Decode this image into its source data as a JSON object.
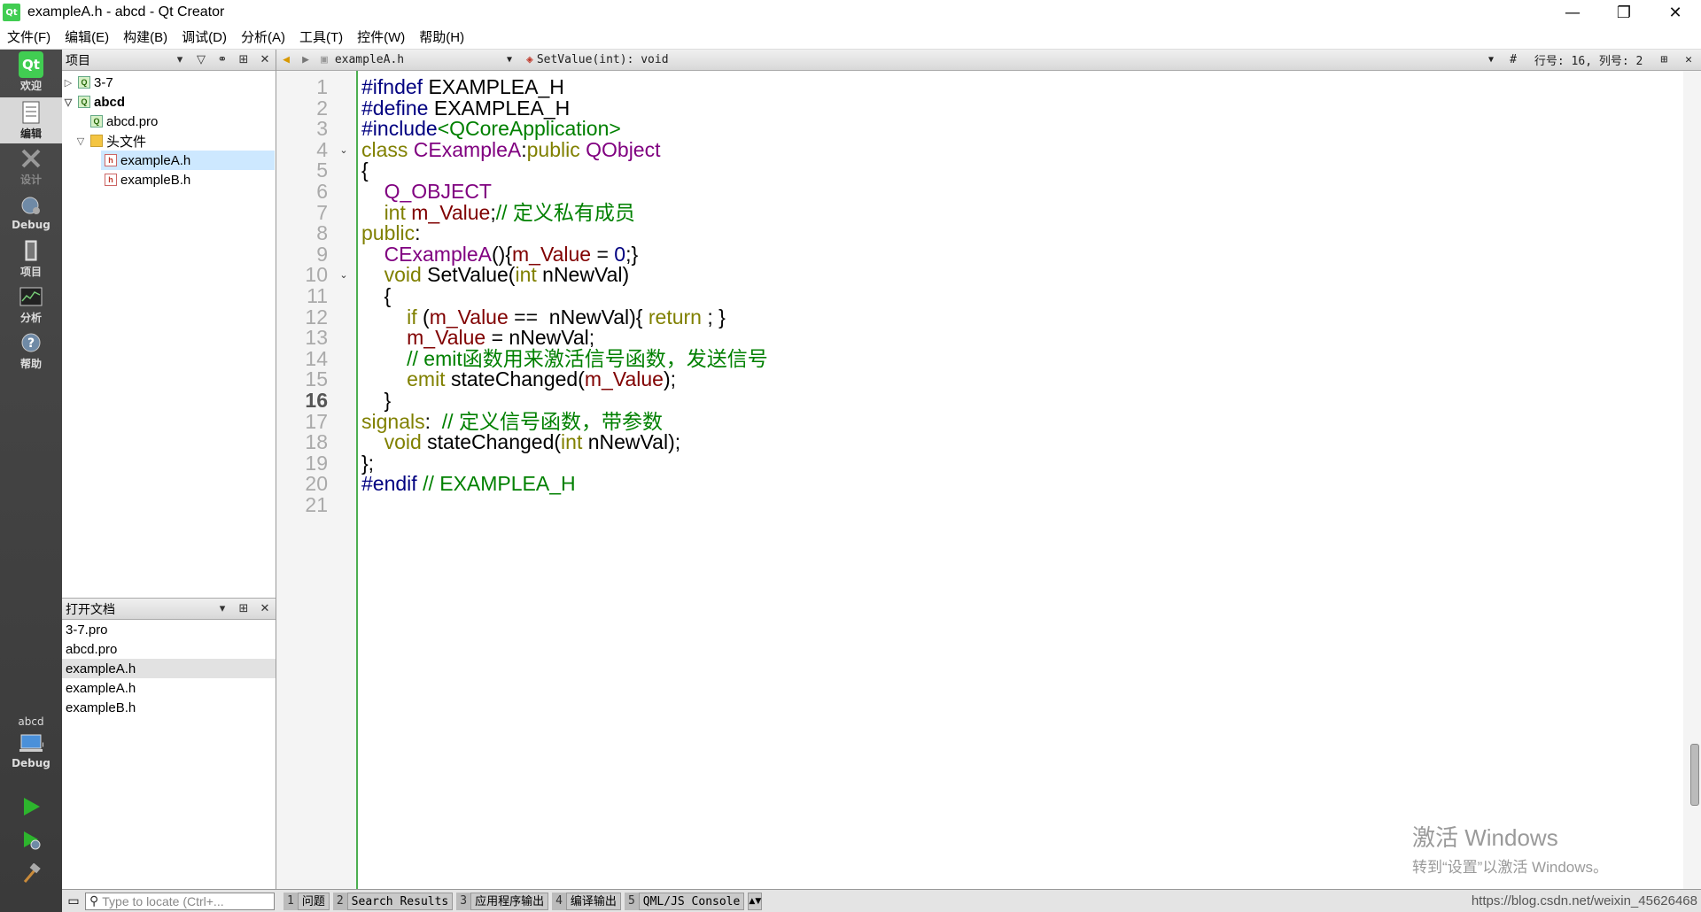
{
  "window": {
    "app_icon": "Qt",
    "title": "exampleA.h - abcd - Qt Creator",
    "buttons": [
      "minimize-icon",
      "restore-icon",
      "close-icon"
    ]
  },
  "menu": [
    "文件(F)",
    "编辑(E)",
    "构建(B)",
    "调试(D)",
    "分析(A)",
    "工具(T)",
    "控件(W)",
    "帮助(H)"
  ],
  "modes": [
    {
      "label": "欢迎",
      "icon": "Qt"
    },
    {
      "label": "编辑",
      "icon": "edit-icon"
    },
    {
      "label": "设计",
      "icon": "design-icon"
    },
    {
      "label": "Debug",
      "icon": "debug-icon"
    },
    {
      "label": "项目",
      "icon": "project-icon"
    },
    {
      "label": "分析",
      "icon": "analyze-icon"
    },
    {
      "label": "帮助",
      "icon": "help-icon"
    }
  ],
  "kit": {
    "project": "abcd",
    "label": "Debug"
  },
  "project_pane": {
    "title": "项目",
    "tree": [
      {
        "label": "3-7",
        "icon": "pro",
        "expanded": false,
        "bold": false
      },
      {
        "label": "abcd",
        "icon": "pro",
        "expanded": true,
        "bold": true
      },
      {
        "label": "abcd.pro",
        "icon": "pro"
      },
      {
        "label": "头文件",
        "icon": "folder",
        "expanded": true
      },
      {
        "label": "exampleA.h",
        "icon": "h",
        "selected": true
      },
      {
        "label": "exampleB.h",
        "icon": "h"
      }
    ]
  },
  "open_docs": {
    "title": "打开文档",
    "items": [
      "3-7.pro",
      "abcd.pro",
      "exampleA.h",
      "exampleA.h",
      "exampleB.h"
    ],
    "selected_index": 2
  },
  "editor_toolbar": {
    "file": "exampleA.h",
    "symbol": "SetValue(int): void",
    "hash": "#",
    "position": "行号: 16, 列号: 2"
  },
  "editor": {
    "current_line": 16,
    "folds": [
      4,
      10
    ],
    "lines": [
      "#ifndef EXAMPLEA_H",
      "#define EXAMPLEA_H",
      "#include<QCoreApplication>",
      "class CExampleA:public QObject",
      "{",
      "    Q_OBJECT",
      "    int m_Value;// 定义私有成员",
      "public:",
      "    CExampleA(){m_Value = 0;}",
      "    void SetValue(int nNewVal)",
      "    {",
      "        if (m_Value ==  nNewVal){ return ; }",
      "        m_Value = nNewVal;",
      "        // emit函数用来激活信号函数，发送信号",
      "        emit stateChanged(m_Value);",
      "    }",
      "signals:  // 定义信号函数，带参数",
      "    void stateChanged(int nNewVal);",
      "};",
      "#endif // EXAMPLEA_H",
      ""
    ]
  },
  "statusbar": {
    "locate_placeholder": "Type to locate (Ctrl+...",
    "tabs": [
      {
        "num": "1",
        "label": "问题"
      },
      {
        "num": "2",
        "label": "Search Results"
      },
      {
        "num": "3",
        "label": "应用程序输出"
      },
      {
        "num": "4",
        "label": "编译输出"
      },
      {
        "num": "5",
        "label": "QML/JS Console"
      }
    ],
    "url": "https://blog.csdn.net/weixin_45626468"
  },
  "watermark": {
    "line1": "激活 Windows",
    "line2": "转到“设置”以激活 Windows。"
  }
}
